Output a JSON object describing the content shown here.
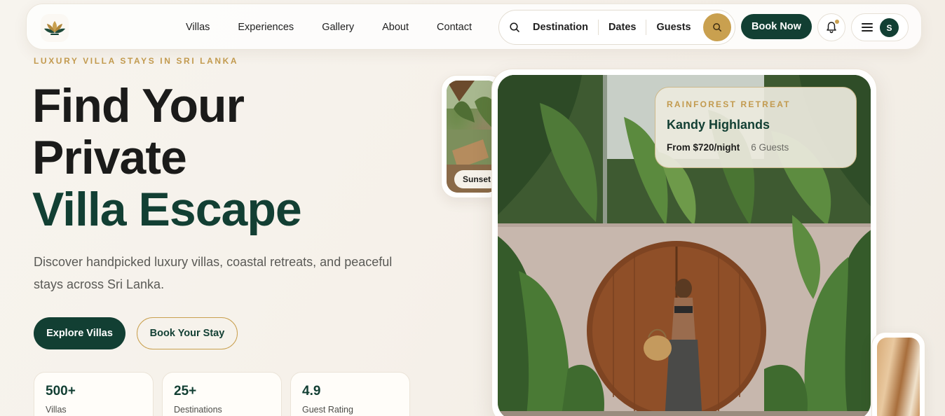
{
  "nav": {
    "links": [
      "Villas",
      "Experiences",
      "Gallery",
      "About",
      "Contact"
    ],
    "search": {
      "destination": "Destination",
      "dates": "Dates",
      "guests": "Guests"
    },
    "book_now": "Book Now",
    "avatar_initial": "S",
    "icons": {
      "logo": "lotus-logo",
      "search": "search-icon",
      "bell": "bell-icon",
      "menu": "menu-icon"
    }
  },
  "hero": {
    "eyebrow": "LUXURY VILLA STAYS IN SRI LANKA",
    "title_line1": "Find Your",
    "title_line2": "Private",
    "title_line3": "Villa Escape",
    "subtitle": "Discover handpicked luxury villas, coastal retreats, and peaceful stays across Sri Lanka.",
    "primary_cta": "Explore Villas",
    "secondary_cta": "Book Your Stay"
  },
  "stats": [
    {
      "value": "500+",
      "label": "Villas"
    },
    {
      "value": "25+",
      "label": "Destinations"
    },
    {
      "value": "4.9",
      "label": "Guest Rating"
    }
  ],
  "thumbnail": {
    "label": "Sunset"
  },
  "featured": {
    "kicker": "RAINFOREST RETREAT",
    "title": "Kandy Highlands",
    "price": "From $720/night",
    "guests": "6 Guests"
  },
  "colors": {
    "brand_green": "#123f33",
    "accent_gold": "#c9a04f",
    "background": "#f7f4ee"
  }
}
